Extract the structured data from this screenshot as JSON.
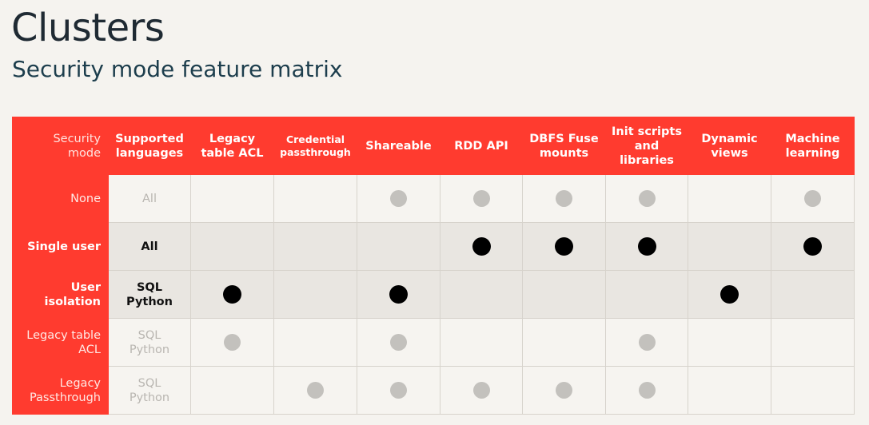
{
  "slide": {
    "title": "Clusters",
    "subtitle": "Security mode feature matrix"
  },
  "matrix": {
    "header": {
      "security_mode": [
        "Security",
        "mode"
      ],
      "supported_languages": [
        "Supported",
        "languages"
      ],
      "features": [
        {
          "lines": [
            "Legacy",
            "table ACL"
          ]
        },
        {
          "lines": [
            "Credential",
            "passthrough"
          ]
        },
        {
          "lines": [
            "Shareable"
          ]
        },
        {
          "lines": [
            "RDD API"
          ]
        },
        {
          "lines": [
            "DBFS Fuse",
            "mounts"
          ]
        },
        {
          "lines": [
            "Init scripts",
            "and",
            "libraries"
          ]
        },
        {
          "lines": [
            "Dynamic",
            "views"
          ]
        },
        {
          "lines": [
            "Machine",
            "learning"
          ]
        }
      ]
    },
    "rows": [
      {
        "mode": [
          "None"
        ],
        "languages": [
          "All"
        ],
        "highlighted": false,
        "support": [
          "none",
          "none",
          "light",
          "light",
          "light",
          "light",
          "none",
          "light"
        ]
      },
      {
        "mode": [
          "Single user"
        ],
        "languages": [
          "All"
        ],
        "highlighted": true,
        "support": [
          "none",
          "none",
          "none",
          "dark",
          "dark",
          "dark",
          "none",
          "dark"
        ]
      },
      {
        "mode": [
          "User isolation"
        ],
        "languages": [
          "SQL",
          "Python"
        ],
        "highlighted": true,
        "support": [
          "dark",
          "none",
          "dark",
          "none",
          "none",
          "none",
          "dark",
          "none"
        ]
      },
      {
        "mode": [
          "Legacy table",
          "ACL"
        ],
        "languages": [
          "SQL",
          "Python"
        ],
        "highlighted": false,
        "support": [
          "light",
          "none",
          "light",
          "none",
          "none",
          "light",
          "none",
          "none"
        ]
      },
      {
        "mode": [
          "Legacy",
          "Passthrough"
        ],
        "languages": [
          "SQL",
          "Python"
        ],
        "highlighted": false,
        "support": [
          "none",
          "light",
          "light",
          "light",
          "light",
          "light",
          "none",
          "none"
        ]
      }
    ]
  }
}
